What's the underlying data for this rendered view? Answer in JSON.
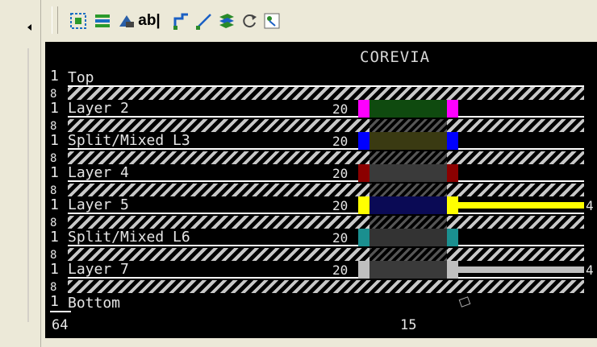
{
  "toolbar": {
    "buttons": [
      {
        "name": "select-net-icon",
        "color": "#1a6fc4"
      },
      {
        "name": "layers-icon",
        "color": "#2b9a2b"
      },
      {
        "name": "via-icon",
        "color": "#2a5fa8"
      },
      {
        "name": "text-icon",
        "label": "ab|"
      },
      {
        "name": "route-icon",
        "color": "#1a5fc4"
      },
      {
        "name": "line-icon",
        "color": "#1a5fc4"
      },
      {
        "name": "stack-icon",
        "color": "#2a8a2a"
      },
      {
        "name": "refresh-icon",
        "color": "#444444"
      },
      {
        "name": "properties-icon",
        "color": "#2a8a2a"
      }
    ]
  },
  "canvas": {
    "title": "COREVIA",
    "layers": [
      {
        "prefix": "1",
        "name": "Top"
      },
      {
        "prefix": "1",
        "name": "Layer 2",
        "width": "20",
        "color": "#ff00ff",
        "fill": "#0f4a0f"
      },
      {
        "prefix": "1",
        "name": "Split/Mixed L3",
        "width": "20",
        "color": "#0000ff",
        "fill": "#3a3a12"
      },
      {
        "prefix": "1",
        "name": "Layer 4",
        "width": "20",
        "color": "#8b0000",
        "fill": "#3a3a3a"
      },
      {
        "prefix": "1",
        "name": "Layer 5",
        "width": "20",
        "color": "#ffff00",
        "fill": "#0a0a55",
        "trace": "#ffff00",
        "end": "4"
      },
      {
        "prefix": "1",
        "name": "Split/Mixed L6",
        "width": "20",
        "color": "#1a8f8f",
        "fill": "#333333"
      },
      {
        "prefix": "1",
        "name": "Layer 7",
        "width": "20",
        "color": "#bfbfbf",
        "fill": "#3a3a3a",
        "trace": "#bfbfbf",
        "end": "4"
      },
      {
        "prefix": "1",
        "name": "Bottom"
      }
    ],
    "dielectric_label": "8",
    "footer_left": "64",
    "footer_center": "15"
  }
}
